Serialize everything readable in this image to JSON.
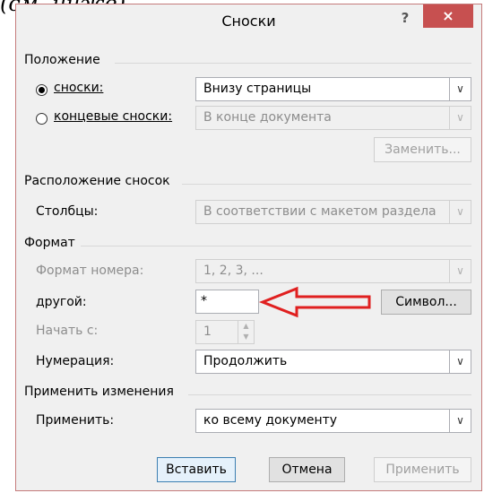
{
  "above_text": "(см. ниже)",
  "dialog": {
    "title": "Сноски",
    "help": "?",
    "close": "×"
  },
  "position": {
    "header": "Положение",
    "footnotes_label": "сноски:",
    "footnotes_value": "Внизу страницы",
    "endnotes_label": "концевые сноски:",
    "endnotes_value": "В конце документа",
    "replace_button": "Заменить..."
  },
  "layout": {
    "header": "Расположение сносок",
    "columns_label": "Столбцы:",
    "columns_value": "В соответствии с макетом раздела"
  },
  "format": {
    "header": "Формат",
    "number_format_label": "Формат номера:",
    "number_format_value": "1, 2, 3, ...",
    "custom_label": "другой:",
    "custom_value": "*",
    "symbol_button": "Символ...",
    "start_label": "Начать с:",
    "start_value": "1",
    "numbering_label": "Нумерация:",
    "numbering_value": "Продолжить"
  },
  "apply": {
    "header": "Применить изменения",
    "apply_label": "Применить:",
    "apply_value": "ко всему документу"
  },
  "buttons": {
    "insert": "Вставить",
    "cancel": "Отмена",
    "apply": "Применить"
  },
  "colors": {
    "annotation_arrow": "#e02020",
    "close_button": "#c75050"
  }
}
